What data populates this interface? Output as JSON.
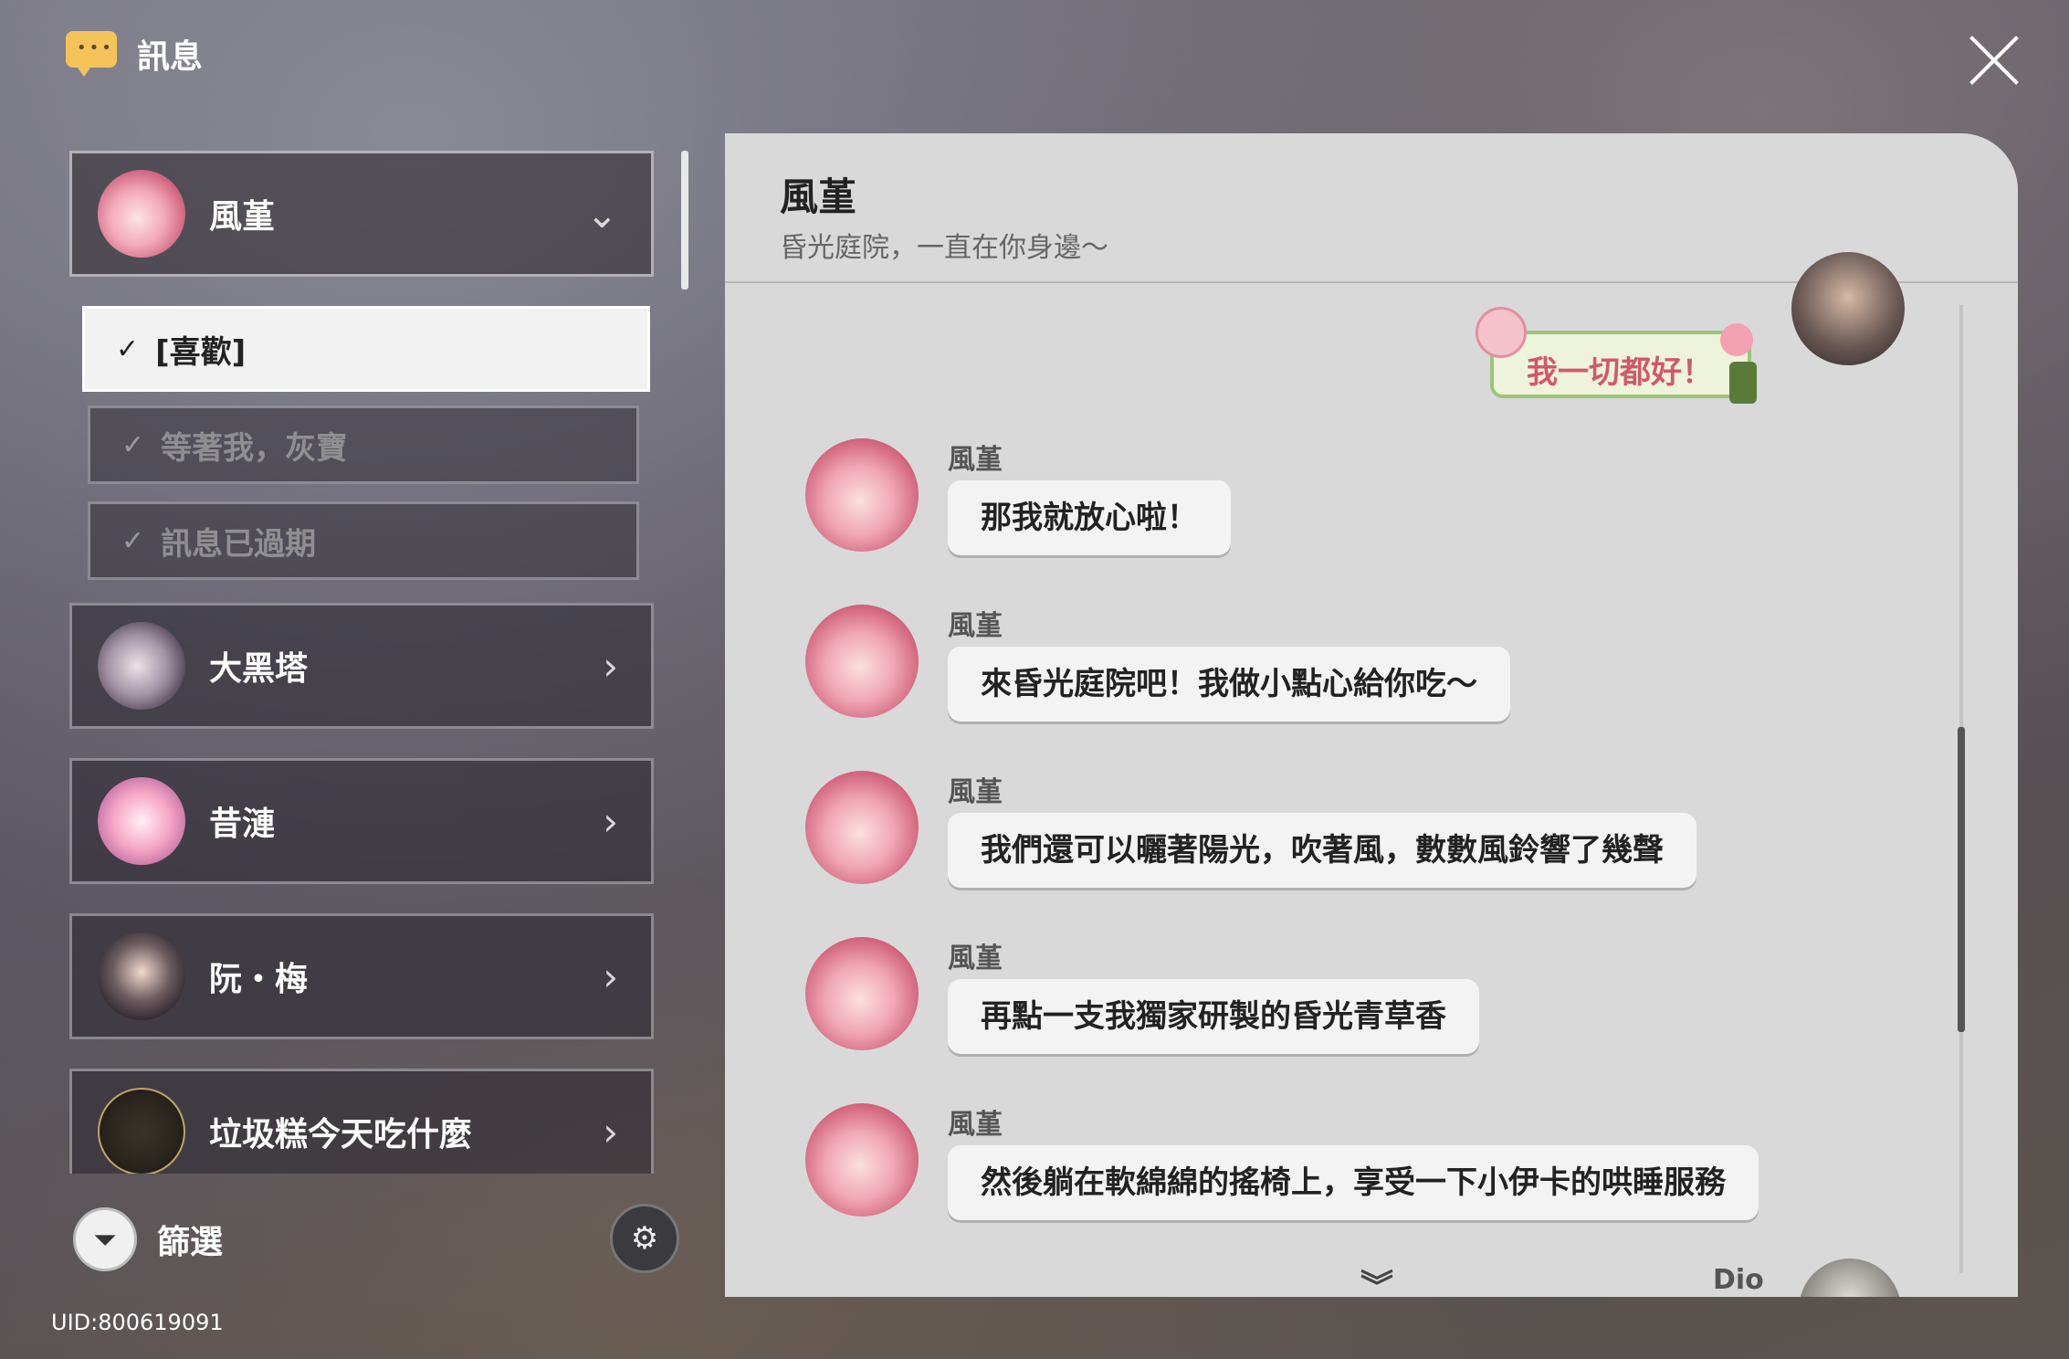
{
  "app": {
    "title": "訊息"
  },
  "contacts": [
    {
      "name": "風堇",
      "expanded": true
    },
    {
      "name": "大黑塔",
      "expanded": false
    },
    {
      "name": "昔漣",
      "expanded": false
    },
    {
      "name": "阮・梅",
      "expanded": false
    },
    {
      "name": "垃圾糕今天吃什麼",
      "expanded": false
    }
  ],
  "threads": [
    {
      "label": "[喜歡]",
      "selected": true
    },
    {
      "label": "等著我，灰寶",
      "selected": false
    },
    {
      "label": "訊息已過期",
      "selected": false
    }
  ],
  "filter": {
    "label": "篩選"
  },
  "uid": "UID:800619091",
  "chat": {
    "name": "風堇",
    "status": "昏光庭院，一直在你身邊～",
    "sticker_text": "我一切都好！",
    "messages": [
      {
        "sender": "風堇",
        "text": "那我就放心啦！"
      },
      {
        "sender": "風堇",
        "text": "來昏光庭院吧！我做小點心給你吃～"
      },
      {
        "sender": "風堇",
        "text": "我們還可以曬著陽光，吹著風，數數風鈴響了幾聲"
      },
      {
        "sender": "風堇",
        "text": "再點一支我獨家研製的昏光青草香"
      },
      {
        "sender": "風堇",
        "text": "然後躺在軟綿綿的搖椅上，享受一下小伊卡的哄睡服務"
      }
    ],
    "next_sender": "Dio"
  },
  "icons": {
    "app": "chat-bubble-icon",
    "close": "close-icon",
    "filter": "filter-funnel-icon",
    "settings": "chat-settings-icon",
    "scroll_down": "double-chevron-down-icon"
  },
  "colors": {
    "accent": "#f4c35a",
    "chat_bg": "#d9d9d9",
    "bubble": "#f3f3f3"
  }
}
